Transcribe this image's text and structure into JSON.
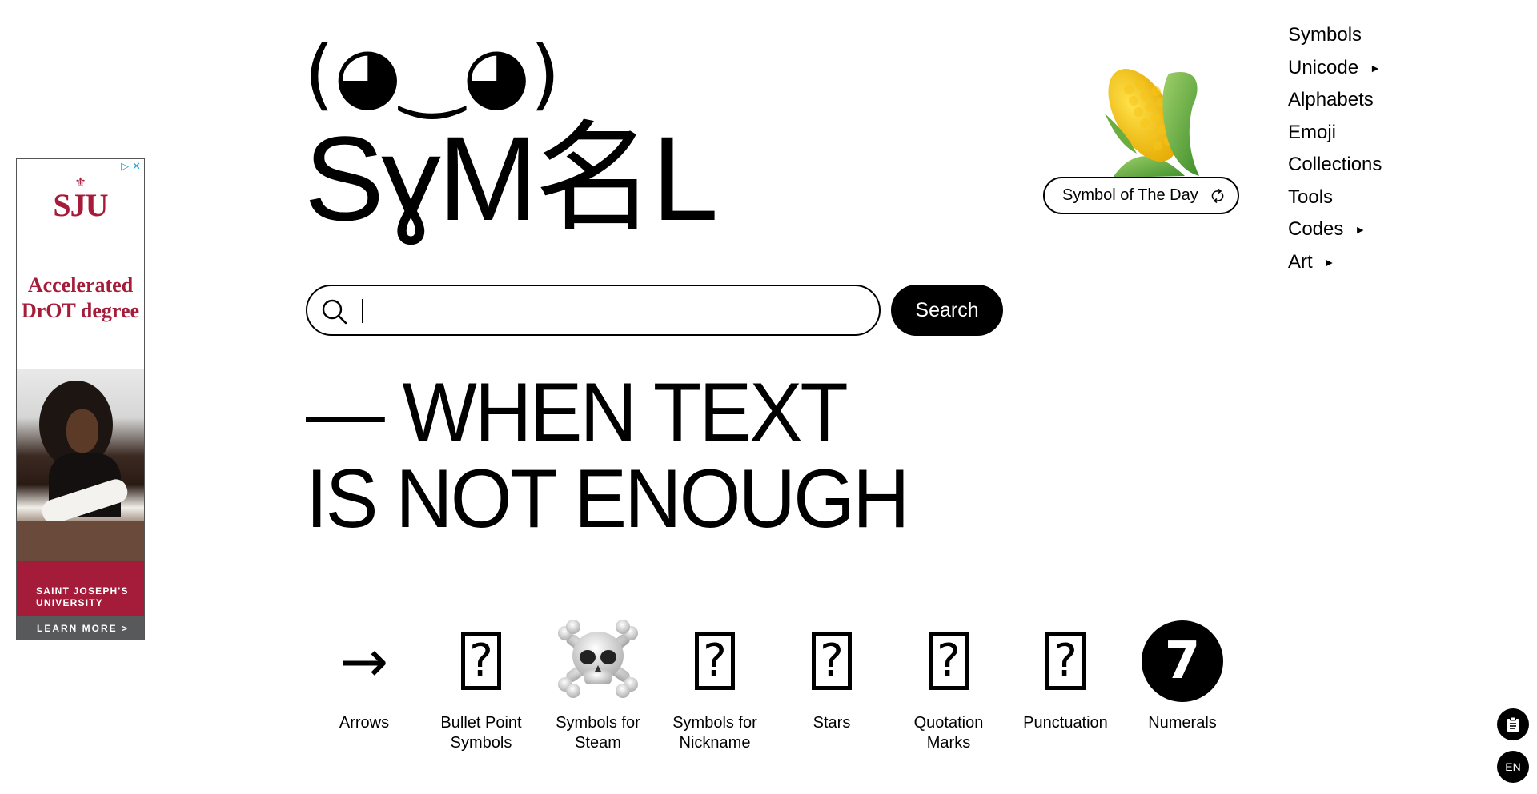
{
  "ad": {
    "adchoices_label": "▷",
    "close_label": "✕",
    "logo_mark": "⚜",
    "logo_text": "SJU",
    "headline": "Accelerated DrOT degree",
    "institution": "SAINT JOSEPH'S UNIVERSITY",
    "cta": "LEARN MORE >",
    "brand_color": "#a51c3a",
    "cta_bg_color": "#58595b"
  },
  "hero": {
    "kaomoji": "(◕‿◕)",
    "logo": "SɣM名L",
    "tagline_line1": "— WHEN TEXT",
    "tagline_line2": "IS NOT ENOUGH"
  },
  "search": {
    "icon": "search-icon",
    "value": "",
    "placeholder": "",
    "button_label": "Search"
  },
  "symbol_of_the_day": {
    "emoji": "🌽",
    "emoji_name": "ear-of-corn",
    "label": "Symbol of The Day",
    "icon": "refresh-icon"
  },
  "nav": {
    "items": [
      {
        "label": "Symbols",
        "has_submenu": false
      },
      {
        "label": "Unicode",
        "has_submenu": true
      },
      {
        "label": "Alphabets",
        "has_submenu": false
      },
      {
        "label": "Emoji",
        "has_submenu": false
      },
      {
        "label": "Collections",
        "has_submenu": false
      },
      {
        "label": "Tools",
        "has_submenu": false
      },
      {
        "label": "Codes",
        "has_submenu": true
      },
      {
        "label": "Art",
        "has_submenu": true
      }
    ],
    "submenu_arrow": "►"
  },
  "categories": [
    {
      "glyph": "→",
      "type": "arrow",
      "label": "Arrows"
    },
    {
      "glyph": "?",
      "type": "missing",
      "label": "Bullet Point\nSymbols"
    },
    {
      "glyph": "☠",
      "type": "skull",
      "label": "Symbols for\nSteam"
    },
    {
      "glyph": "?",
      "type": "missing",
      "label": "Symbols for\nNickname"
    },
    {
      "glyph": "?",
      "type": "missing",
      "label": "Stars"
    },
    {
      "glyph": "?",
      "type": "missing",
      "label": "Quotation\nMarks"
    },
    {
      "glyph": "?",
      "type": "missing",
      "label": "Punctuation"
    },
    {
      "glyph": "7",
      "type": "circle",
      "label": "Numerals"
    }
  ],
  "floating": {
    "clipboard_icon": "clipboard-icon",
    "language_label": "EN"
  }
}
